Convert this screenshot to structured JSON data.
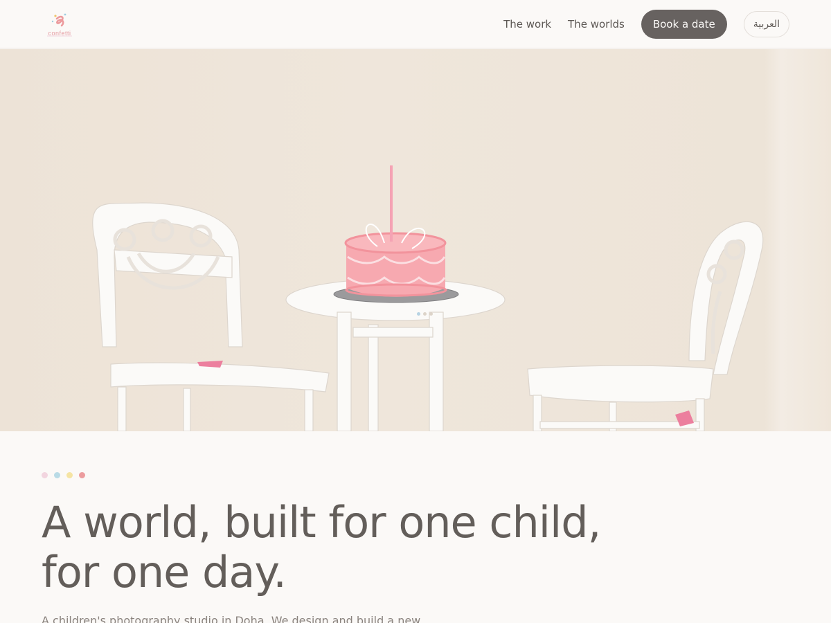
{
  "header": {
    "logo_text": "confetti",
    "nav": [
      {
        "label": "The work"
      },
      {
        "label": "The worlds"
      }
    ],
    "book_label": "Book a date",
    "lang_label": "العربية"
  },
  "intro": {
    "dot_colors": [
      "#f2d5df",
      "#b9dbe6",
      "#f5e4a3",
      "#ec9c9e"
    ],
    "headline_line1": "A world, built for one child,",
    "headline_line2": "for one day.",
    "subtext": "A children's photography studio in Doha. We design and build a new"
  }
}
